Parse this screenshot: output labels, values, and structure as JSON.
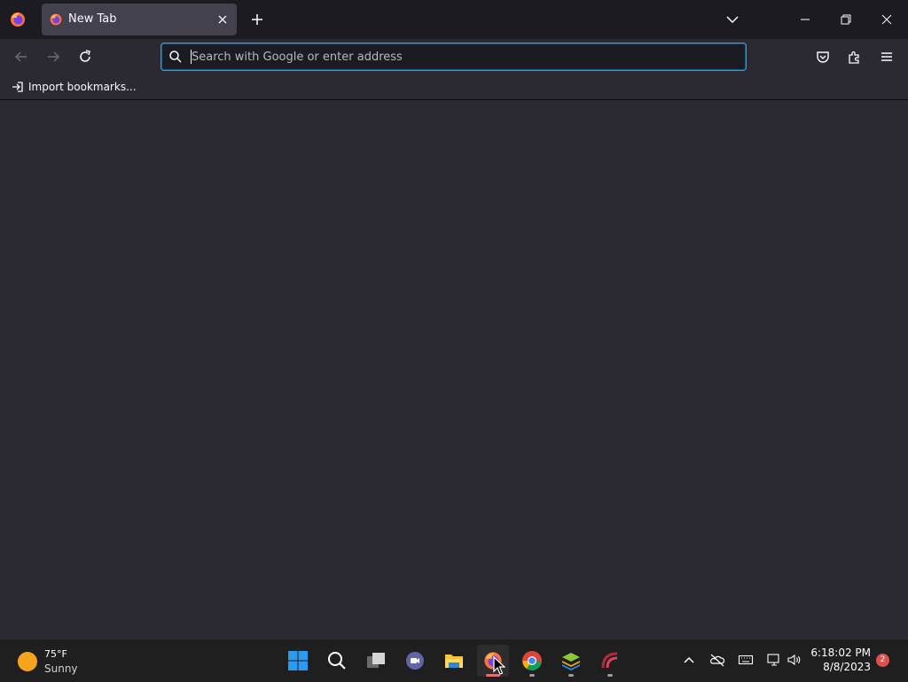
{
  "browser": {
    "tab": {
      "title": "New Tab"
    },
    "urlbar": {
      "placeholder": "Search with Google or enter address",
      "value": ""
    },
    "bookmarks_bar": {
      "import_label": "Import bookmarks..."
    },
    "icons": {
      "app_menu": "firefox-icon",
      "tab_favicon": "firefox-icon",
      "tab_close": "close-icon",
      "new_tab": "plus-icon",
      "tab_list": "chevron-down-icon",
      "back": "arrow-left-icon",
      "forward": "arrow-right-icon",
      "reload": "reload-icon",
      "search": "search-icon",
      "pocket": "pocket-icon",
      "extensions": "puzzle-icon",
      "menu": "hamburger-menu-icon",
      "import": "import-icon"
    }
  },
  "window_controls": {
    "minimize": "minimize-icon",
    "restore": "restore-icon",
    "close": "close-icon"
  },
  "taskbar": {
    "weather": {
      "temp": "75°F",
      "condition": "Sunny"
    },
    "apps": [
      "start",
      "search",
      "task-view",
      "teams-chat",
      "file-explorer",
      "firefox",
      "chrome",
      "bluestacks",
      "app-red-arc"
    ],
    "active_app": "firefox",
    "clock": {
      "time": "6:18:02 PM",
      "date": "8/8/2023"
    },
    "notification_count": "2"
  },
  "colors": {
    "toolbar_bg": "#2b2a33",
    "tabstrip_bg": "#1c1b22",
    "selected_tab_bg": "#42414d",
    "urlbar_focus_border": "#5b8fb9",
    "taskbar_bg": "#1f1f1f",
    "notification_badge": "#e0514b"
  }
}
